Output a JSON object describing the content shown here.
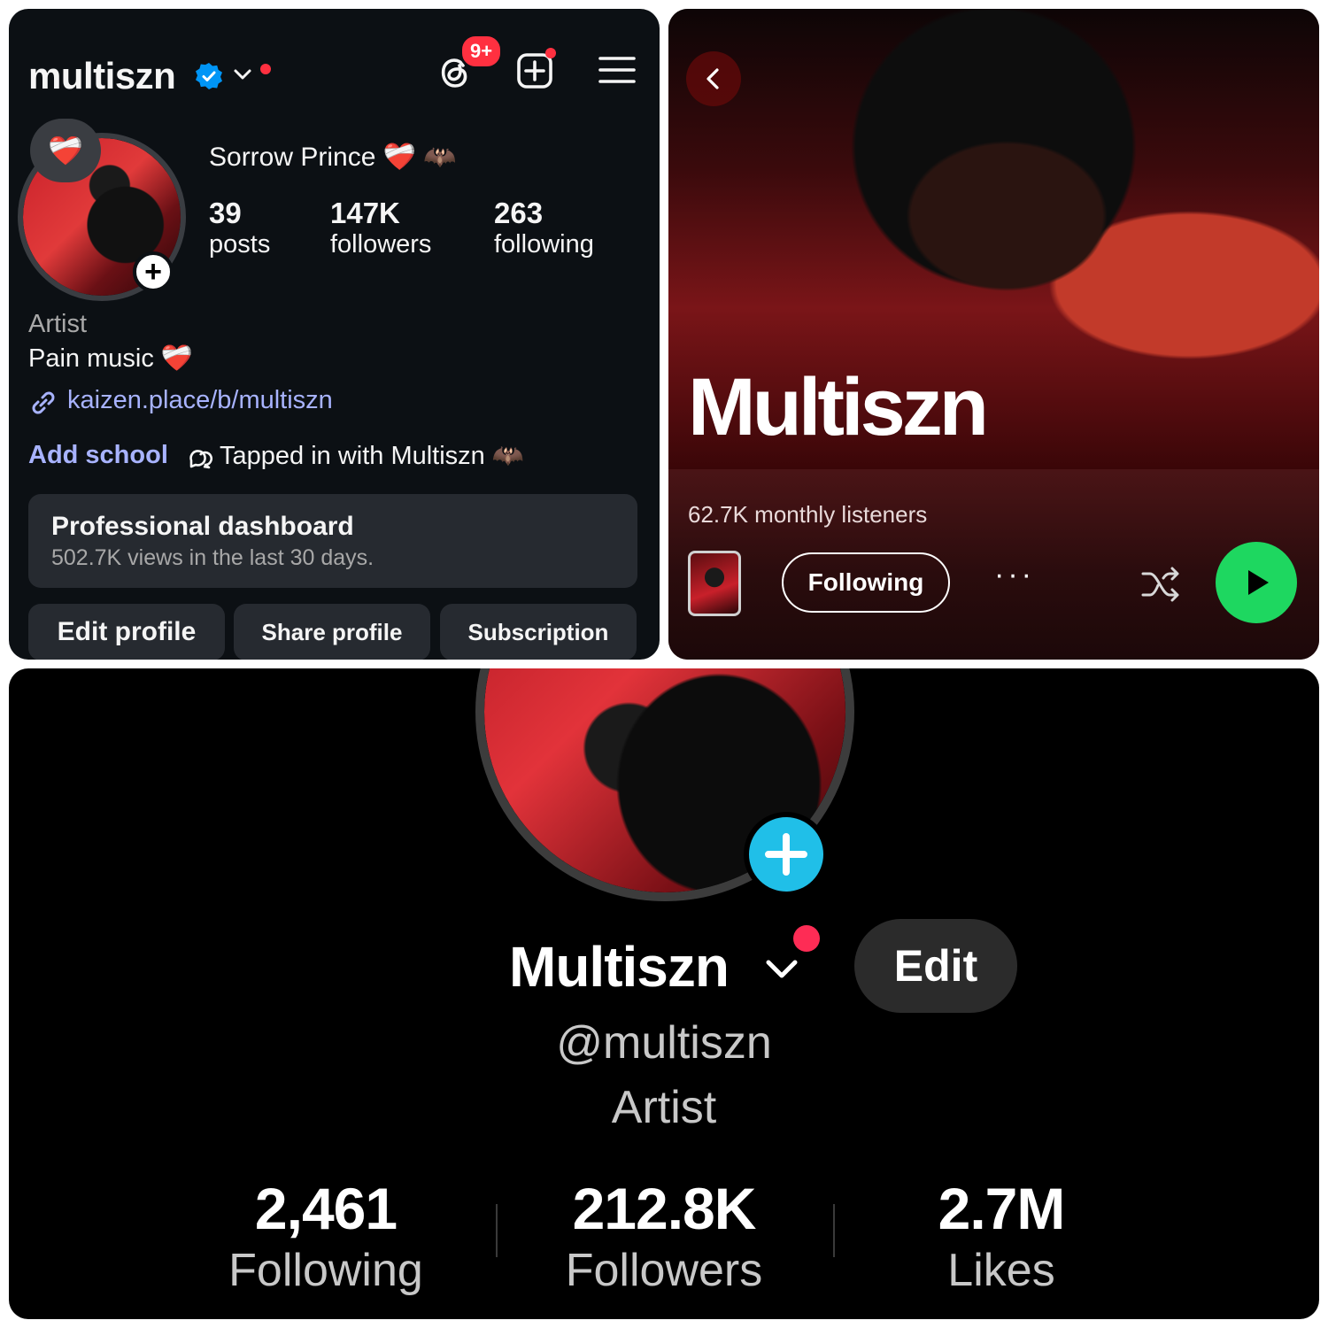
{
  "instagram": {
    "username": "multiszn",
    "notifications_badge": "9+",
    "note_emoji": "❤️‍🩹",
    "display_name": "Sorrow Prince ❤️‍🩹 🦇",
    "stats": [
      {
        "value": "39",
        "label": "posts"
      },
      {
        "value": "147K",
        "label": "followers"
      },
      {
        "value": "263",
        "label": "following"
      }
    ],
    "category": "Artist",
    "bio": "Pain music ❤️‍🩹",
    "link": "kaizen.place/b/multiszn",
    "add_school": "Add school",
    "tapped_in": "Tapped in with Multiszn 🦇",
    "dashboard_title": "Professional dashboard",
    "dashboard_sub": "502.7K views in the last 30 days.",
    "buttons": [
      "Edit profile",
      "Share profile",
      "Subscription"
    ],
    "accent_link": "#a8b3ff",
    "verified_color": "#0095f6"
  },
  "spotify": {
    "artist_name": "Multiszn",
    "monthly_listeners": "62.7K monthly listeners",
    "follow_label": "Following",
    "more_label": "···",
    "play_color": "#1ed760"
  },
  "tiktok": {
    "name": "Multiszn",
    "edit_label": "Edit",
    "handle": "@multiszn",
    "bio": "Artist",
    "stats": [
      {
        "value": "2,461",
        "label": "Following"
      },
      {
        "value": "212.8K",
        "label": "Followers"
      },
      {
        "value": "2.7M",
        "label": "Likes"
      }
    ],
    "plus_color": "#20bfe8",
    "dot_color": "#fe2c55"
  }
}
